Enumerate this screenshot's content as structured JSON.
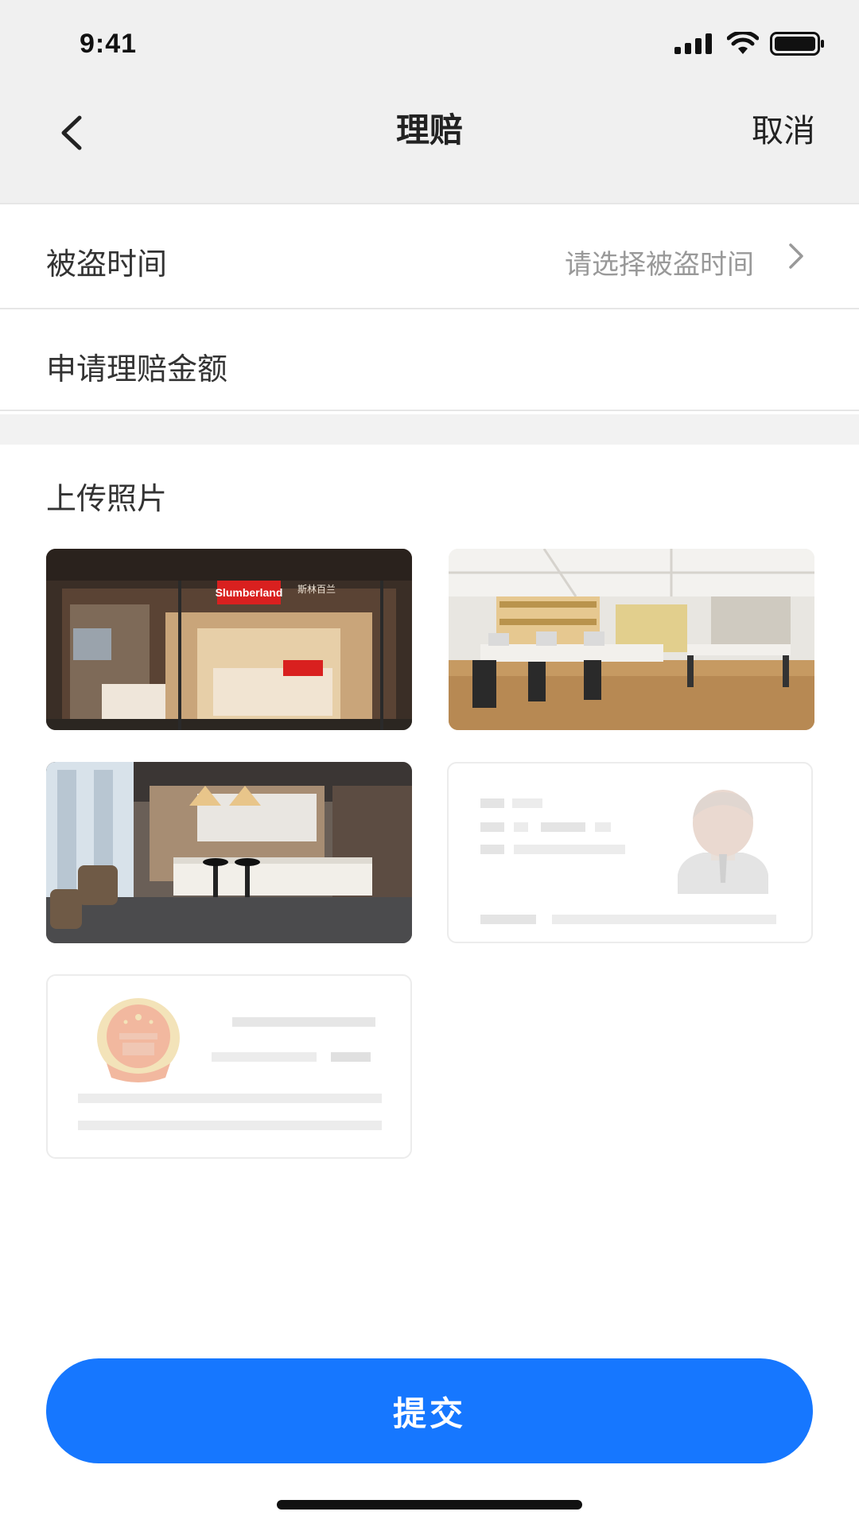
{
  "status_bar": {
    "time": "9:41"
  },
  "nav": {
    "title": "理赔",
    "cancel_label": "取消"
  },
  "form": {
    "theft_time": {
      "label": "被盗时间",
      "placeholder": "请选择被盗时间"
    },
    "claim_amount": {
      "label": "申请理赔金额"
    }
  },
  "upload": {
    "title": "上传照片",
    "photos": [
      {
        "name": "store-front-photo",
        "brand_sign": "Slumberland",
        "sign_text": "斯林百兰"
      },
      {
        "name": "office-photo"
      },
      {
        "name": "kitchen-photo"
      },
      {
        "name": "id-card-front-placeholder"
      },
      {
        "name": "id-card-emblem-placeholder"
      }
    ]
  },
  "submit_label": "提交",
  "colors": {
    "primary": "#1677ff",
    "nav_bg": "#f0f0f0",
    "placeholder_text": "#999999"
  }
}
